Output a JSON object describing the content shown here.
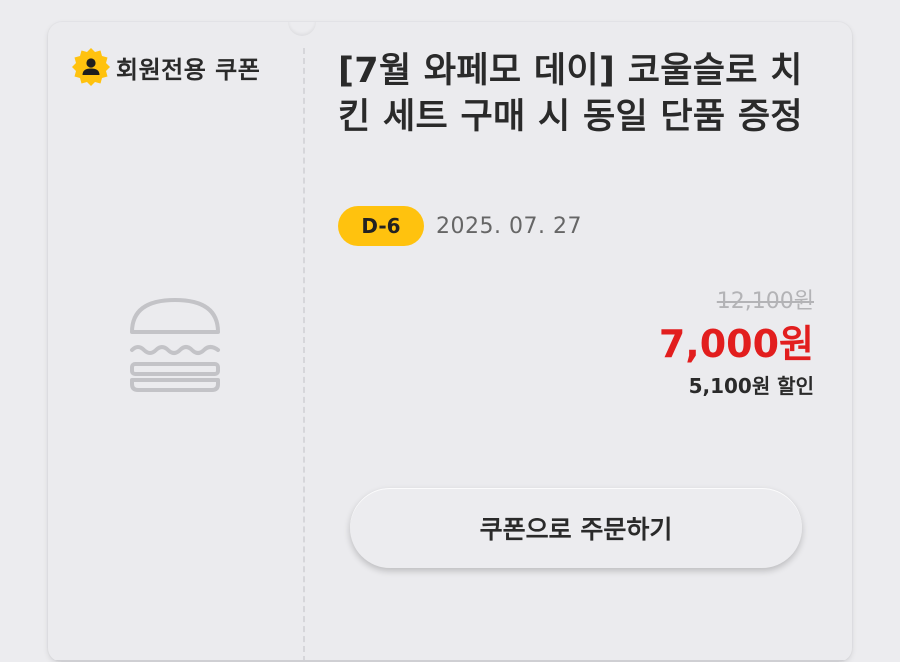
{
  "coupon": {
    "member_badge": "회원전용 쿠폰",
    "member_icon": "member-person-icon",
    "product_icon": "burger-icon",
    "title": "[7월 와페모 데이] 코울슬로 치킨 세트 구매 시 동일 단품 증정",
    "d_day": "D-6",
    "expiry_date": "2025. 07. 27",
    "original_price": "12,100원",
    "sale_price": "7,000원",
    "discount_text": "5,100원 할인",
    "order_button": "쿠폰으로 주문하기"
  },
  "colors": {
    "background": "#ececef",
    "accent_yellow": "#ffc20e",
    "sale_red": "#e21e1e",
    "text_dark": "#2a2a2a",
    "text_muted": "#b3b3b6"
  }
}
